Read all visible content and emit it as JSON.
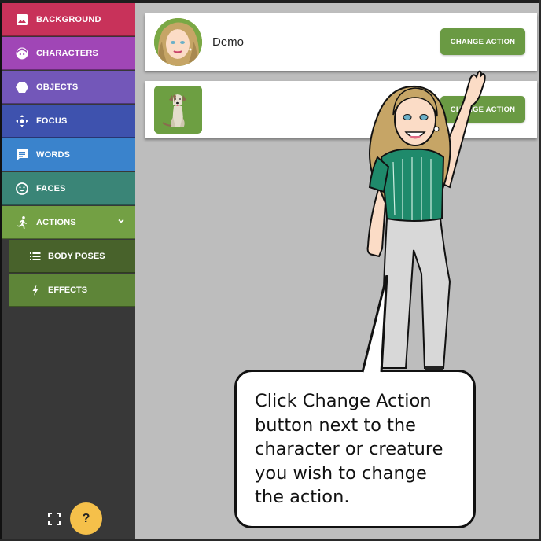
{
  "sidebar": {
    "items": [
      {
        "label": "BACKGROUND",
        "icon": "image-icon",
        "color": "#c8325a"
      },
      {
        "label": "CHARACTERS",
        "icon": "character-face-icon",
        "color": "#a046b6"
      },
      {
        "label": "OBJECTS",
        "icon": "hexagon-icon",
        "color": "#7357b9"
      },
      {
        "label": "FOCUS",
        "icon": "move-arrows-icon",
        "color": "#3e52ae"
      },
      {
        "label": "WORDS",
        "icon": "speech-bubble-icon",
        "color": "#3a83cc"
      },
      {
        "label": "FACES",
        "icon": "smiley-icon",
        "color": "#3a8577"
      },
      {
        "label": "ACTIONS",
        "icon": "running-person-icon",
        "color": "#73a044",
        "expanded": true
      }
    ],
    "subitems": [
      {
        "label": "BODY POSES",
        "icon": "list-icon",
        "color": "#48622b"
      },
      {
        "label": "EFFECTS",
        "icon": "lightning-icon",
        "color": "#5e8538"
      }
    ],
    "help_label": "?"
  },
  "main": {
    "cards": [
      {
        "name": "Demo",
        "avatar": "woman-avatar",
        "button_label": "CHANGE ACTION"
      },
      {
        "name": "",
        "avatar": "dog-avatar",
        "button_label": "CHANGE ACTION"
      }
    ],
    "accent_color": "#6a9a43"
  },
  "tutorial": {
    "bubble_text": "Click Change Action button next to the character or creature you wish to change the action."
  }
}
